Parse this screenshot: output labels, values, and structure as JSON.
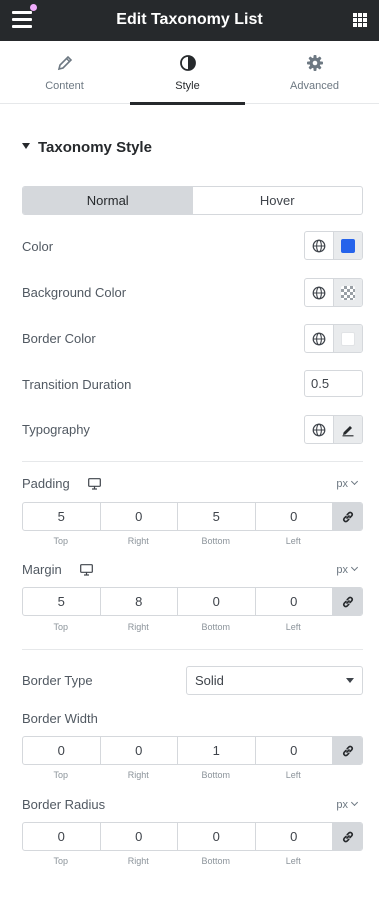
{
  "header": {
    "title": "Edit Taxonomy List"
  },
  "tabs": [
    {
      "label": "Content",
      "icon": "pencil-icon"
    },
    {
      "label": "Style",
      "icon": "half-circle-icon"
    },
    {
      "label": "Advanced",
      "icon": "gear-icon"
    }
  ],
  "section": {
    "title": "Taxonomy Style"
  },
  "state_switcher": {
    "normal": "Normal",
    "hover": "Hover",
    "active": "Normal"
  },
  "controls": {
    "color": {
      "label": "Color",
      "value": "#2563EB"
    },
    "background_color": {
      "label": "Background Color"
    },
    "border_color": {
      "label": "Border Color"
    },
    "transition_duration": {
      "label": "Transition Duration",
      "value": "0.5"
    },
    "typography": {
      "label": "Typography"
    }
  },
  "dimension_labels": {
    "top": "Top",
    "right": "Right",
    "bottom": "Bottom",
    "left": "Left"
  },
  "padding": {
    "label": "Padding",
    "unit": "px",
    "top": "5",
    "right": "0",
    "bottom": "5",
    "left": "0"
  },
  "margin": {
    "label": "Margin",
    "unit": "px",
    "top": "5",
    "right": "8",
    "bottom": "0",
    "left": "0"
  },
  "border_type": {
    "label": "Border Type",
    "value": "Solid"
  },
  "border_width": {
    "label": "Border Width",
    "top": "0",
    "right": "0",
    "bottom": "1",
    "left": "0"
  },
  "border_radius": {
    "label": "Border Radius",
    "unit": "px",
    "top": "0",
    "right": "0",
    "bottom": "0",
    "left": "0"
  }
}
